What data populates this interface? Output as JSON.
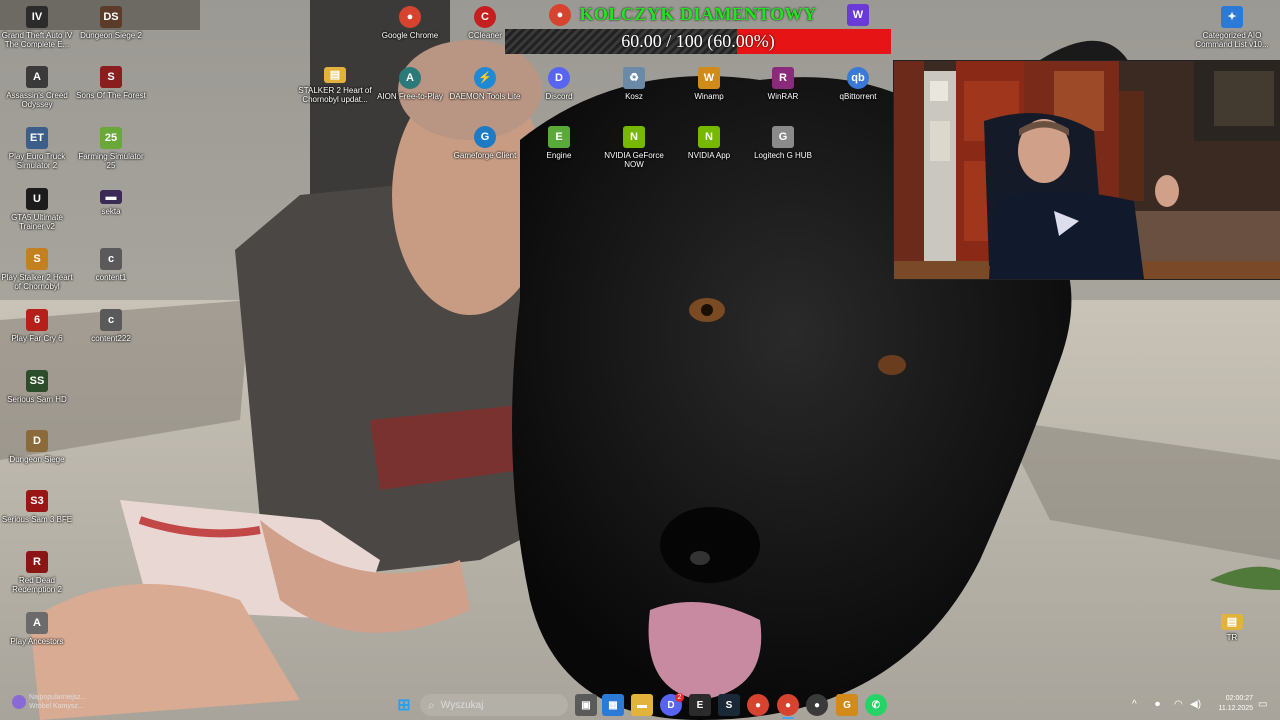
{
  "desktop": {
    "icons": [
      {
        "label": "Grand Theft Auto IV The Complete E...",
        "glyph": "IV",
        "color": "#2b2b2b"
      },
      {
        "label": "Dungeon Siege 2",
        "glyph": "DS",
        "color": "#5b3b2a"
      },
      {
        "label": "Assassin's Creed Odyssey",
        "glyph": "A",
        "color": "#3a3a3a"
      },
      {
        "label": "Sons Of The Forest",
        "glyph": "S",
        "color": "#8a1d1d"
      },
      {
        "label": "Play Euro Truck Simulator 2",
        "glyph": "ET",
        "color": "#3b5f8a"
      },
      {
        "label": "Farming Simulator 25",
        "glyph": "25",
        "color": "#6aa83a"
      },
      {
        "label": "GTA5 Ultimate Trainer v2",
        "glyph": "U",
        "color": "#1c1c1c"
      },
      {
        "label": "sekta",
        "glyph": "▬",
        "color": "#3a2a55"
      },
      {
        "label": "Play Stalker 2 Heart of Chornobyl",
        "glyph": "S",
        "color": "#c2811e"
      },
      {
        "label": "content1",
        "glyph": "c",
        "color": "#5a5a5a"
      },
      {
        "label": "Play Far Cry 6",
        "glyph": "6",
        "color": "#b5201a"
      },
      {
        "label": "content222",
        "glyph": "c",
        "color": "#5a5a5a"
      },
      {
        "label": "Serious Sam HD",
        "glyph": "SS",
        "color": "#2d4d2a"
      },
      {
        "label": "Dungeon Siege",
        "glyph": "D",
        "color": "#8a6a3a"
      },
      {
        "label": "Serious Sam 3 BFE",
        "glyph": "S3",
        "color": "#9a1515"
      },
      {
        "label": "Red Dead Redemption 2",
        "glyph": "R",
        "color": "#8a1515"
      },
      {
        "label": "Play Ancestors",
        "glyph": "A",
        "color": "#6b6b6b"
      },
      {
        "label": "Google Chrome",
        "glyph": "●",
        "color": "#d6442f"
      },
      {
        "label": "CCleaner",
        "glyph": "C",
        "color": "#c51f1f"
      },
      {
        "label": "STALKER 2 Heart of Chornobyl updat...",
        "glyph": "▤",
        "color": "#e2b33a"
      },
      {
        "label": "AION Free-to-Play",
        "glyph": "A",
        "color": "#2a7a7a"
      },
      {
        "label": "DAEMON Tools Lite",
        "glyph": "⚡",
        "color": "#1e8ad6"
      },
      {
        "label": "Discord",
        "glyph": "D",
        "color": "#5865f2"
      },
      {
        "label": "Kosz",
        "glyph": "♻",
        "color": "#6a8aa8"
      },
      {
        "label": "Winamp",
        "glyph": "W",
        "color": "#d28a1a"
      },
      {
        "label": "WinRAR",
        "glyph": "R",
        "color": "#8a2a7a"
      },
      {
        "label": "qBittorrent",
        "glyph": "qb",
        "color": "#3a7ad6"
      },
      {
        "label": "Gameforge Client",
        "glyph": "G",
        "color": "#1e7ac2"
      },
      {
        "label": "Engine",
        "glyph": "E",
        "color": "#5aaa3a"
      },
      {
        "label": "NVIDIA GeForce NOW",
        "glyph": "N",
        "color": "#76b900"
      },
      {
        "label": "NVIDIA App",
        "glyph": "N",
        "color": "#76b900"
      },
      {
        "label": "Logitech G HUB",
        "glyph": "G",
        "color": "#8a8a8a"
      },
      {
        "label": "Categorized AIO Command List v10...",
        "glyph": "✦",
        "color": "#2a7ad6"
      },
      {
        "label": "TR",
        "glyph": "▤",
        "color": "#e2b33a"
      }
    ],
    "top_partial_icons": [
      {
        "label": "",
        "glyph": "●",
        "color": "#d6442f"
      },
      {
        "label": "",
        "glyph": "W",
        "color": "#6a3ad6"
      }
    ]
  },
  "donation_goal": {
    "title": "KOLCZYK DIAMENTOWY",
    "text": "60.00 / 100 (60.00%)",
    "progress": 0.6,
    "fill_color": "#e61414"
  },
  "taskbar": {
    "news_line1": "Najpopularniejsz...",
    "news_line2": "Wróbel Kamysz...",
    "search_placeholder": "Wyszukaj",
    "apps": [
      {
        "name": "windows",
        "glyph": "⊞",
        "color": "#2aa0f0"
      },
      {
        "name": "file-viewer",
        "glyph": "▣",
        "color": "#5a5a5a"
      },
      {
        "name": "photos",
        "glyph": "▦",
        "color": "#2a7ad6"
      },
      {
        "name": "file-explorer",
        "glyph": "▬",
        "color": "#e2b33a"
      },
      {
        "name": "discord",
        "glyph": "D",
        "color": "#5865f2"
      },
      {
        "name": "epic",
        "glyph": "E",
        "color": "#2b2b2b"
      },
      {
        "name": "steam",
        "glyph": "S",
        "color": "#1b2838"
      },
      {
        "name": "chrome",
        "glyph": "●",
        "color": "#d6442f"
      },
      {
        "name": "chrome-alt",
        "glyph": "●",
        "color": "#d6442f"
      },
      {
        "name": "obs",
        "glyph": "●",
        "color": "#3a3a3a"
      },
      {
        "name": "guild",
        "glyph": "G",
        "color": "#d28a1a"
      },
      {
        "name": "whatsapp",
        "glyph": "✆",
        "color": "#25d366"
      }
    ],
    "discord_badge": "2",
    "time": "02:00:27",
    "date": "11.12.2025"
  }
}
